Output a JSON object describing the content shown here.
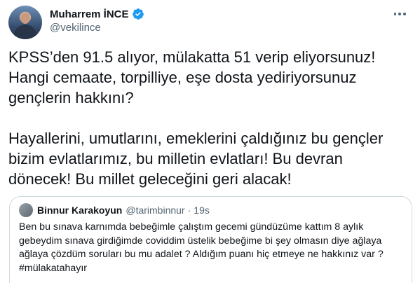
{
  "tweet": {
    "author": {
      "display_name": "Muharrem İNCE",
      "handle": "@vekilince",
      "verified": true
    },
    "text": "KPSS’den 91.5 alıyor, mülakatta 51 verip eliyorsunuz!\nHangi cemaate, torpilliye, eşe dosta yediriyorsunuz\ngençlerin hakkını?\n\nHayallerini, umutlarını, emeklerini çaldığınız bu gençler\nbizim evlatlarımız, bu milletin evlatları! Bu devran\ndönecek! Bu millet geleceğini geri alacak!",
    "more_icon": "more-horizontal-icon"
  },
  "quoted_tweet": {
    "author": {
      "display_name": "Binnur Karakoyun",
      "handle": "@tarimbinnur"
    },
    "separator": "·",
    "time": "19s",
    "text": "Ben bu sınava karnımda bebeğimle çalıştım gecemi gündüzüme kattım 8 aylık\ngebeydim sınava girdiğimde covid­dim üstelik bebeğime bi şey olmasın diye ağlaya\nağlaya çözdüm soruları bu mu adalet ? Aldığım puanı hiç etmeye ne hakkınız var ?\n#mülakatahayır"
  },
  "colors": {
    "text": "#0f1419",
    "secondary": "#536471",
    "verified": "#1d9bf0",
    "border": "#cfd9de"
  }
}
